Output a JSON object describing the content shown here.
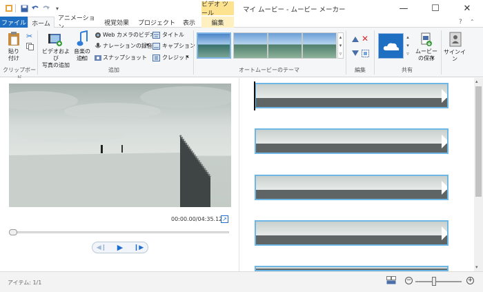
{
  "titlebar": {
    "context_tab_title": "ビデオ ツール",
    "app_title": "マイ ムービー - ムービー メーカー",
    "minimize_glyph": "—",
    "maximize_glyph": "☐",
    "close_glyph": "✕"
  },
  "tabs": {
    "file": "ファイル",
    "home": "ホーム",
    "animation": "アニメーション",
    "visual_effects": "視覚効果",
    "project": "プロジェクト",
    "view": "表示",
    "edit": "編集"
  },
  "ribbon": {
    "clipboard": {
      "paste": "貼り\n付け",
      "group_label": "クリップボード"
    },
    "add": {
      "add_videos_photos": "ビデオおよび\n写真の追加",
      "add_music": "音楽の\n追加",
      "webcam_video": "Web カメラのビデオ",
      "record_narration": "ナレーションの録音",
      "snapshot": "スナップショット",
      "title": "タイトル",
      "caption": "キャプション",
      "credits": "クレジット",
      "group_label": "追加"
    },
    "automovie": {
      "group_label": "オートムービーのテーマ"
    },
    "editing": {
      "group_label": "編集"
    },
    "share": {
      "save_movie": "ムービー\nの保存",
      "group_label": "共有"
    },
    "signin": {
      "label": "サインイン"
    }
  },
  "preview": {
    "time": "00:00.00/04:35.12",
    "progress": 0
  },
  "storyboard": {
    "clips": 5
  },
  "status": {
    "items": "アイテム: 1/1"
  },
  "colors": {
    "accent": "#1e6fc2",
    "context_tab": "#fde28f",
    "clip_border": "#6db7e6",
    "control_blue": "#1f6cd1"
  },
  "zoom": {
    "level": 0.4
  }
}
